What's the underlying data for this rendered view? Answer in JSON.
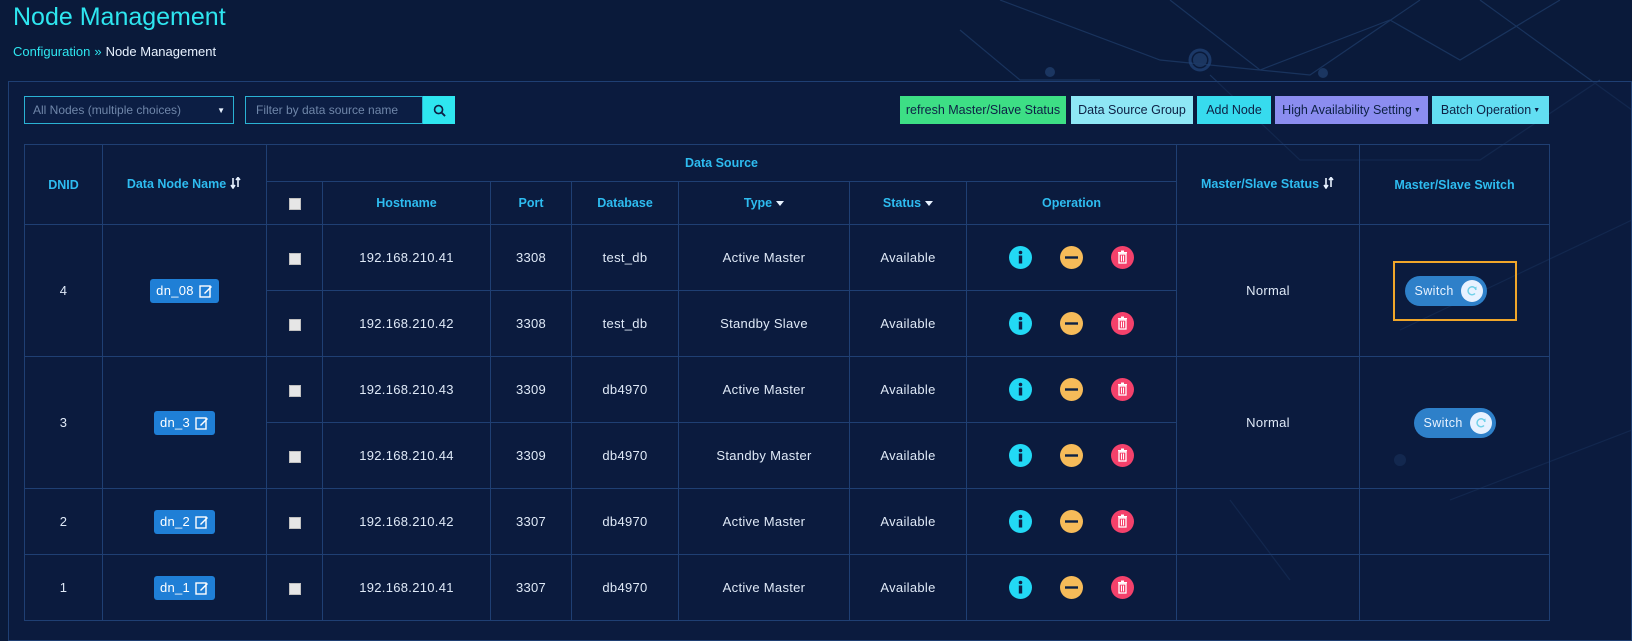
{
  "header": {
    "title": "Node Management",
    "breadcrumb": {
      "parent": "Configuration",
      "separator": "»",
      "current": "Node Management"
    }
  },
  "filters": {
    "node_select_value": "All Nodes (multiple choices)",
    "search_placeholder": "Filter by data source name"
  },
  "toolbar": {
    "refresh": "refresh Master/Slave Status",
    "data_source_group": "Data Source Group",
    "add_node": "Add Node",
    "high_availability": "High Availability Setting",
    "batch_operation": "Batch Operation"
  },
  "colors": {
    "accent": "#2ee6f0",
    "refresh": "#3ddf85",
    "data_source_group": "#8ee7f5",
    "add_node": "#37dbee",
    "high_availability": "#8b8df0",
    "batch_operation": "#62def2",
    "available_active": "#3df08a",
    "available_standby": "#36c2e8",
    "highlight": "#f0a62a"
  },
  "table": {
    "headers": {
      "dnid": "DNID",
      "data_node_name": "Data Node Name",
      "data_source": "Data Source",
      "hostname": "Hostname",
      "port": "Port",
      "database": "Database",
      "type": "Type",
      "status": "Status",
      "operation": "Operation",
      "master_slave_status": "Master/Slave Status",
      "master_slave_switch": "Master/Slave Switch"
    },
    "switch_label": "Switch",
    "groups": [
      {
        "dnid": "4",
        "node_name": "dn_08",
        "ms_status": "Normal",
        "switch": true,
        "highlighted": true,
        "rows": [
          {
            "hostname": "192.168.210.41",
            "port": "3308",
            "database": "test_db",
            "type": "Active Master",
            "status": "Available"
          },
          {
            "hostname": "192.168.210.42",
            "port": "3308",
            "database": "test_db",
            "type": "Standby Slave",
            "status": "Available"
          }
        ]
      },
      {
        "dnid": "3",
        "node_name": "dn_3",
        "ms_status": "Normal",
        "switch": true,
        "highlighted": false,
        "rows": [
          {
            "hostname": "192.168.210.43",
            "port": "3309",
            "database": "db4970",
            "type": "Active Master",
            "status": "Available"
          },
          {
            "hostname": "192.168.210.44",
            "port": "3309",
            "database": "db4970",
            "type": "Standby Master",
            "status": "Available"
          }
        ]
      },
      {
        "dnid": "2",
        "node_name": "dn_2",
        "ms_status": "",
        "switch": false,
        "highlighted": false,
        "rows": [
          {
            "hostname": "192.168.210.42",
            "port": "3307",
            "database": "db4970",
            "type": "Active Master",
            "status": "Available"
          }
        ]
      },
      {
        "dnid": "1",
        "node_name": "dn_1",
        "ms_status": "",
        "switch": false,
        "highlighted": false,
        "rows": [
          {
            "hostname": "192.168.210.41",
            "port": "3307",
            "database": "db4970",
            "type": "Active Master",
            "status": "Available"
          }
        ]
      }
    ]
  }
}
